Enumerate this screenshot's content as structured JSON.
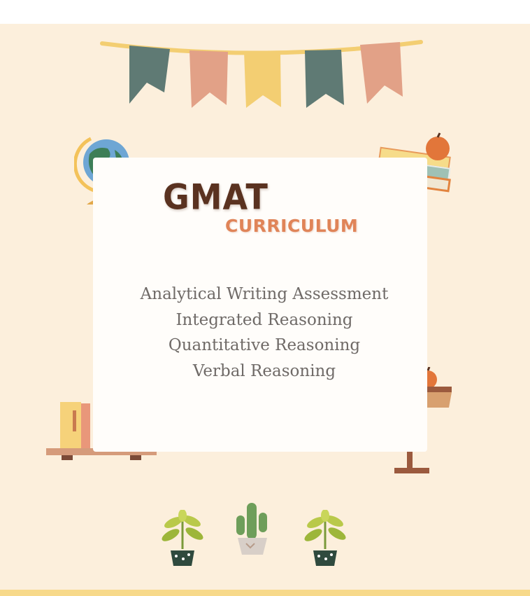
{
  "title": {
    "main": "GMAT",
    "sub": "CURRICULUM"
  },
  "topics": [
    "Analytical Writing Assessment",
    "Integrated Reasoning",
    "Quantitative Reasoning",
    "Verbal Reasoning"
  ],
  "colors": {
    "background": "#fcefdc",
    "card": "#fffdfa",
    "title_main": "#5a3220",
    "title_sub": "#e08458",
    "topic_text": "#6f6a67",
    "bunting_teal": "#5f7a74",
    "bunting_peach": "#e2a187",
    "bunting_yellow": "#f3ce72"
  },
  "decorations": [
    "bunting-banner",
    "globe-icon",
    "book-stack-with-apple",
    "bookshelf",
    "school-desk-with-pencil-and-apple",
    "potted-plant",
    "potted-cactus",
    "potted-plant"
  ]
}
